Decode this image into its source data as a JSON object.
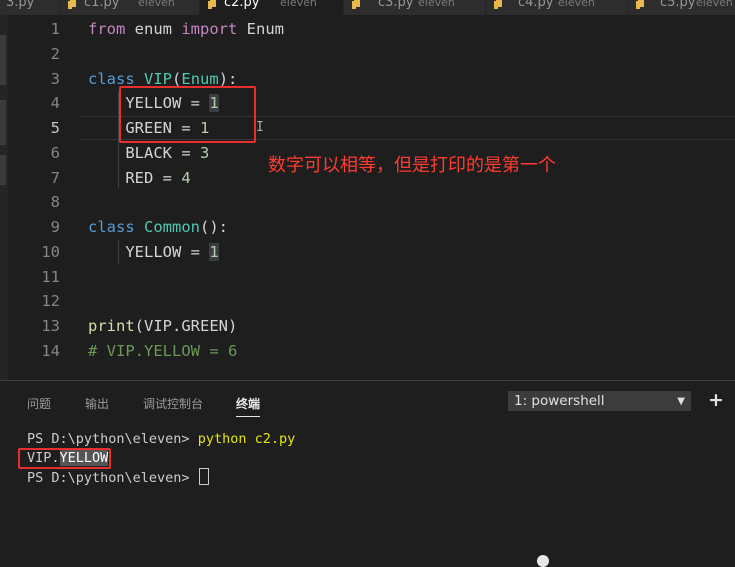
{
  "tabs": [
    {
      "name": "3.py",
      "desc": ""
    },
    {
      "name": "c1.py",
      "desc": "eleven"
    },
    {
      "name": "c2.py",
      "desc": "eleven",
      "active": true
    },
    {
      "name": "c3.py",
      "desc": "eleven"
    },
    {
      "name": "c4.py",
      "desc": "eleven"
    },
    {
      "name": "c5.py",
      "desc": "eleven"
    }
  ],
  "editor": {
    "line_numbers": [
      "1",
      "2",
      "3",
      "4",
      "5",
      "6",
      "7",
      "8",
      "9",
      "10",
      "11",
      "12",
      "13",
      "14"
    ],
    "l1": {
      "kw_from": "from",
      "mod": " enum ",
      "kw_import": "import",
      "name": " Enum"
    },
    "l3": {
      "kw_class": "class",
      "name": "VIP",
      "open": "(",
      "base": "Enum",
      "close": "):"
    },
    "l4": {
      "indent": "    ",
      "text": "YELLOW = ",
      "num": "1"
    },
    "l5": {
      "indent": "    ",
      "text": "GREEN = ",
      "num": "1"
    },
    "l6": {
      "indent": "    ",
      "text": "BLACK = ",
      "num": "3"
    },
    "l7": {
      "indent": "    ",
      "text": "RED = ",
      "num": "4"
    },
    "l9": {
      "kw_class": "class",
      "name": "Common",
      "tail": "():"
    },
    "l10": {
      "indent": "    ",
      "text": "YELLOW = ",
      "num": "1"
    },
    "l13": {
      "fn": "print",
      "args": "(VIP.GREEN)"
    },
    "l14": {
      "comment": "# VIP.YELLOW = 6"
    }
  },
  "annotation": "数字可以相等，但是打印的是第一个",
  "panel": {
    "tabs": [
      "问题",
      "输出",
      "调试控制台",
      "终端"
    ],
    "active_tab": "终端",
    "shell_selected": "1: powershell",
    "add_label": "+"
  },
  "terminal": {
    "prompt1": "PS D:\\python\\eleven> ",
    "command": "python c2.py",
    "output_prefix": "VIP.",
    "output_selected": "YELLOW",
    "prompt2": "PS D:\\python\\eleven> "
  },
  "colors": {
    "annotation_red": "#ff3b2f",
    "keyword": "#c586c0",
    "class_name": "#4ec9b0",
    "number": "#b5cea8",
    "command_yellow": "#e5e510"
  }
}
